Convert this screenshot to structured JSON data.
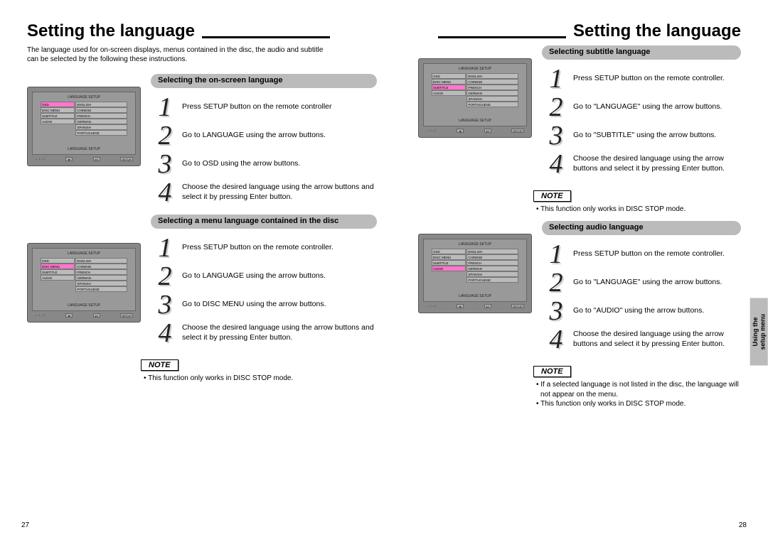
{
  "left": {
    "title": "Setting the language",
    "intro": "The language used for on-screen displays, menus contained in the disc, the audio and subtitle can be selected by the following these instructions.",
    "pageNum": "27",
    "tvHeader": "LANGUAGE SETUP",
    "tvFooter": "LANGUAGE SETUP",
    "menuLeft": [
      "OSD",
      "DISC MENU",
      "SUBTITLE",
      "AUDIO"
    ],
    "menuRight": [
      "ENGLISH",
      "CHINESE",
      "FRENCH",
      "GERMAN",
      "SPANISH",
      "PORTUGUESE"
    ],
    "sections": [
      {
        "header": "Selecting the on-screen language",
        "steps": [
          "Press SETUP button on the remote controller",
          "Go to LANGUAGE using the arrow buttons.",
          "Go to OSD using the arrow buttons.",
          "Choose the desired language using the arrow buttons and select it  by pressing Enter button."
        ]
      },
      {
        "header": "Selecting a menu language contained in the disc",
        "steps": [
          "Press SETUP button on the remote controller.",
          "Go to LANGUAGE using the arrow buttons.",
          "Go to DISC MENU using the arrow buttons.",
          "Choose the desired language using the arrow buttons and select it by pressing Enter button."
        ],
        "noteLabel": "NOTE",
        "notes": [
          "This function only works in DISC STOP mode."
        ]
      }
    ]
  },
  "right": {
    "title": "Setting the language",
    "pageNum": "28",
    "sideTab1": "Using the",
    "sideTab2": "setup menu",
    "sections": [
      {
        "header": "Selecting subtitle language",
        "steps": [
          "Press SETUP button on the remote controller.",
          "Go to \"LANGUAGE\" using the arrow buttons.",
          "Go to \"SUBTITLE\" using the arrow buttons.",
          "Choose the desired language using the arrow buttons and select it by pressing Enter button."
        ],
        "noteLabel": "NOTE",
        "notes": [
          "This function only works in DISC STOP mode."
        ]
      },
      {
        "header": "Selecting audio language",
        "steps": [
          "Press SETUP button on the remote controller.",
          "Go to \"LANGUAGE\" using the arrow buttons.",
          "Go to \"AUDIO\" using the arrow buttons.",
          "Choose the desired language using the arrow buttons and select it by pressing Enter button."
        ],
        "noteLabel": "NOTE",
        "notes": [
          "If a selected language is not listed in the disc, the language will not appear on the menu.",
          "This function only works in DISC STOP mode."
        ]
      }
    ]
  }
}
